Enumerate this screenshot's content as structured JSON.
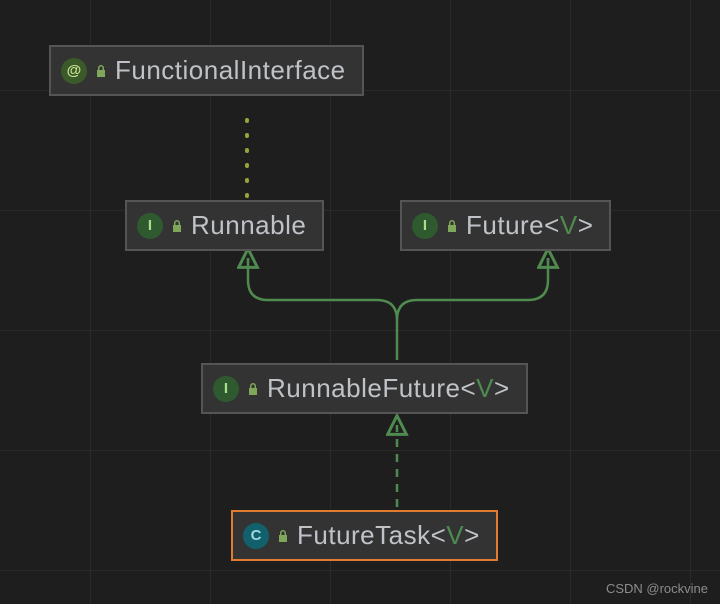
{
  "chart_data": {
    "type": "graph",
    "description": "Java class hierarchy diagram",
    "edges": [
      {
        "from": "Runnable",
        "to": "FunctionalInterface",
        "style": "dotted",
        "relation": "annotation"
      },
      {
        "from": "RunnableFuture<V>",
        "to": "Runnable",
        "style": "solid",
        "relation": "extends"
      },
      {
        "from": "RunnableFuture<V>",
        "to": "Future<V>",
        "style": "solid",
        "relation": "extends"
      },
      {
        "from": "FutureTask<V>",
        "to": "RunnableFuture<V>",
        "style": "dashed",
        "relation": "implements"
      }
    ]
  },
  "nodes": {
    "functionalInterface": {
      "name": "FunctionalInterface",
      "badge": "@",
      "kind": "annotation"
    },
    "runnable": {
      "name": "Runnable",
      "badge": "I",
      "kind": "interface"
    },
    "future": {
      "name": "Future",
      "badge": "I",
      "kind": "interface",
      "generic": "V"
    },
    "runnableFuture": {
      "name": "RunnableFuture",
      "badge": "I",
      "kind": "interface",
      "generic": "V"
    },
    "futureTask": {
      "name": "FutureTask",
      "badge": "C",
      "kind": "class",
      "generic": "V"
    }
  },
  "watermark": "CSDN @rockvine",
  "colors": {
    "edge": "#4f8a4f",
    "highlight": "#e07b2f",
    "bg": "#1e1e1e"
  }
}
